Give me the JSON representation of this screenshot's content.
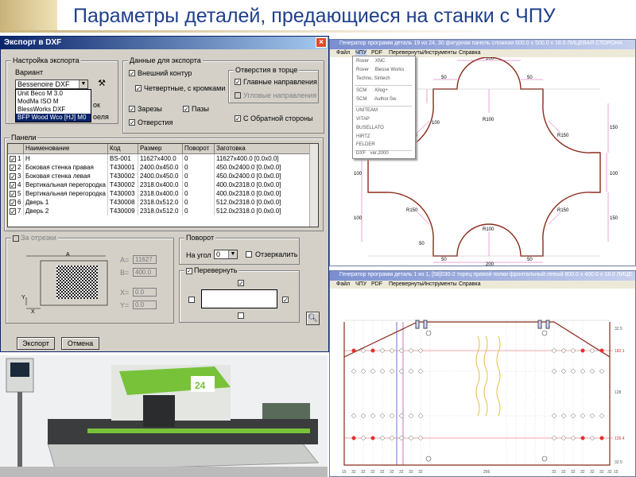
{
  "slide": {
    "title": "Параметры деталей, предающиеся на станки с ЧПУ"
  },
  "dialog": {
    "title": "Экспорт в DXF",
    "settings_group": "Настройка экспорта",
    "variant_label": "Вариант",
    "variant_value": "Bessenoire DXF",
    "variant_options": [
      "Unit Beco M 3.0",
      "ModMa ISO M",
      "BlessWorks DXF",
      "BFP Wood Wco [HJ] M0"
    ],
    "partial_label_1": "ок",
    "partial_label_2": "оеля",
    "export_data_group": "Данные для экспорта",
    "outer_contour": "Внешний контур",
    "quarter_label": "Четвертные, с кромками",
    "cuts_label": "Зарезы",
    "grooves_label": "Пазы",
    "holes_label": "Отверстия",
    "openings_group": "Отверстия в торце",
    "main_directions": "Главные направления",
    "pre_directions": "Угловые направления",
    "reversed_side": "С Обратной стороны",
    "panels_group": "Панели",
    "columns": [
      "",
      "Наименование",
      "Код",
      "Размер",
      "Поворот",
      "Заготовка"
    ],
    "rows": [
      {
        "n": "1",
        "name": "Н",
        "code": "BS-001",
        "size": "11627x400.0",
        "rot": "0",
        "blank": "11627x400.0 [0.0x0.0]"
      },
      {
        "n": "2",
        "name": "Боковая стенка правая",
        "code": "T430001",
        "size": "2400.0x450.0",
        "rot": "0",
        "blank": "450.0x2400.0 [0.0x0.0]"
      },
      {
        "n": "3",
        "name": "Боковая стенка левая",
        "code": "T430002",
        "size": "2400.0x450.0",
        "rot": "0",
        "blank": "450.0x2400.0 [0.0x0.0]"
      },
      {
        "n": "4",
        "name": "Вертикальная перегородка 1",
        "code": "T430002",
        "size": "2318.0x400.0",
        "rot": "0",
        "blank": "400.0x2318.0 [0.0x0.0]"
      },
      {
        "n": "5",
        "name": "Вертикальная перегородка 2",
        "code": "T430003",
        "size": "2318.0x400.0",
        "rot": "0",
        "blank": "400.0x2318.0 [0.0x0.0]"
      },
      {
        "n": "6",
        "name": "Дверь 1",
        "code": "T430008",
        "size": "2318.0x512.0",
        "rot": "0",
        "blank": "512.0x2318.0 [0.0x0.0]"
      },
      {
        "n": "7",
        "name": "Дверь 2",
        "code": "T430009",
        "size": "2318.0x512.0",
        "rot": "0",
        "blank": "512.0x2318.0 [0.0x0.0]"
      }
    ],
    "blank_group": "За отрезки",
    "dim_a": "A",
    "dim_x": "X",
    "dim_y": "Y",
    "field_a_label": "A=",
    "field_a_value": "11627",
    "field_b_label": "B=",
    "field_b_value": "400.0",
    "field_x_label": "X=",
    "field_x_value": "0.0",
    "field_y_label": "Y=",
    "field_y_value": "0.0",
    "rotation_group": "Поворот",
    "rotation_label": "На угол",
    "rotation_value": "0",
    "mirror_label": "Отзеркалить",
    "flip_group": "Перевернуть",
    "export_btn": "Экспорт",
    "cancel_btn": "Отмена"
  },
  "top_window": {
    "title": "Генератор программ    деталь 19 из 24,   30  фигурная панель сложная  600.0 x 500.0 x 18.0    ЛИЦЕВАЯ СТОРОНА",
    "menu": [
      "Файл",
      "ЧПУ",
      "PDF",
      "Перевернуть",
      "Инструменты",
      "Справка"
    ],
    "popup": [
      {
        "a": "Rover",
        "b": "XNC"
      },
      {
        "a": "Rover",
        "b": "Biesse Works"
      },
      {
        "a": "Techno, Sintech",
        "b": ""
      },
      {
        "a": "SCM",
        "b": "Xilog+"
      },
      {
        "a": "SCM",
        "b": "Author.Sw"
      },
      {
        "a": "UNITEAM",
        "b": ""
      },
      {
        "a": "VITAP",
        "b": ""
      },
      {
        "a": "BUSELLATO",
        "b": ""
      },
      {
        "a": "HIRTZ",
        "b": ""
      },
      {
        "a": "FELDER",
        "b": ""
      },
      {
        "a": "DXF",
        "b": "ver.2000"
      }
    ],
    "dims": {
      "top_200": "200",
      "d100a": "100",
      "d50a": "50",
      "d50b": "50",
      "r100_top": "R100",
      "r150_tr": "R150",
      "r150_tl": "R150",
      "r150_br": "R150",
      "r150_bl": "R150",
      "r100_bot": "R100",
      "d100_l": "100",
      "d100_r": "100",
      "d150_r": "150",
      "d150_r2": "150",
      "d150_l": "150",
      "d100_l2": "100",
      "d50_bl": "50",
      "d200_bot": "200",
      "d50_br": "50",
      "d50_bl2": "50"
    }
  },
  "bottom_window": {
    "title": "Генератор программ    деталь 1 из 1,   [58]030-2  торец правой полки фронтальный левый  800.0 x 400.0 x 18.0   ЛИЦЕ",
    "menu": [
      "Файл",
      "ЧПУ",
      "PDF",
      "Перевернуть",
      "Инструменты",
      "Справка"
    ],
    "right_ticks": [
      "32.5",
      "182.1",
      "128",
      "126.4",
      "32.5"
    ],
    "bottom_ticks": [
      "15",
      "32",
      "32",
      "32",
      "32",
      "32",
      "32",
      "32",
      "32",
      "256",
      "32",
      "32",
      "32",
      "32",
      "32",
      "32",
      "32",
      "15"
    ]
  },
  "photo": {
    "panel_number": "24"
  }
}
